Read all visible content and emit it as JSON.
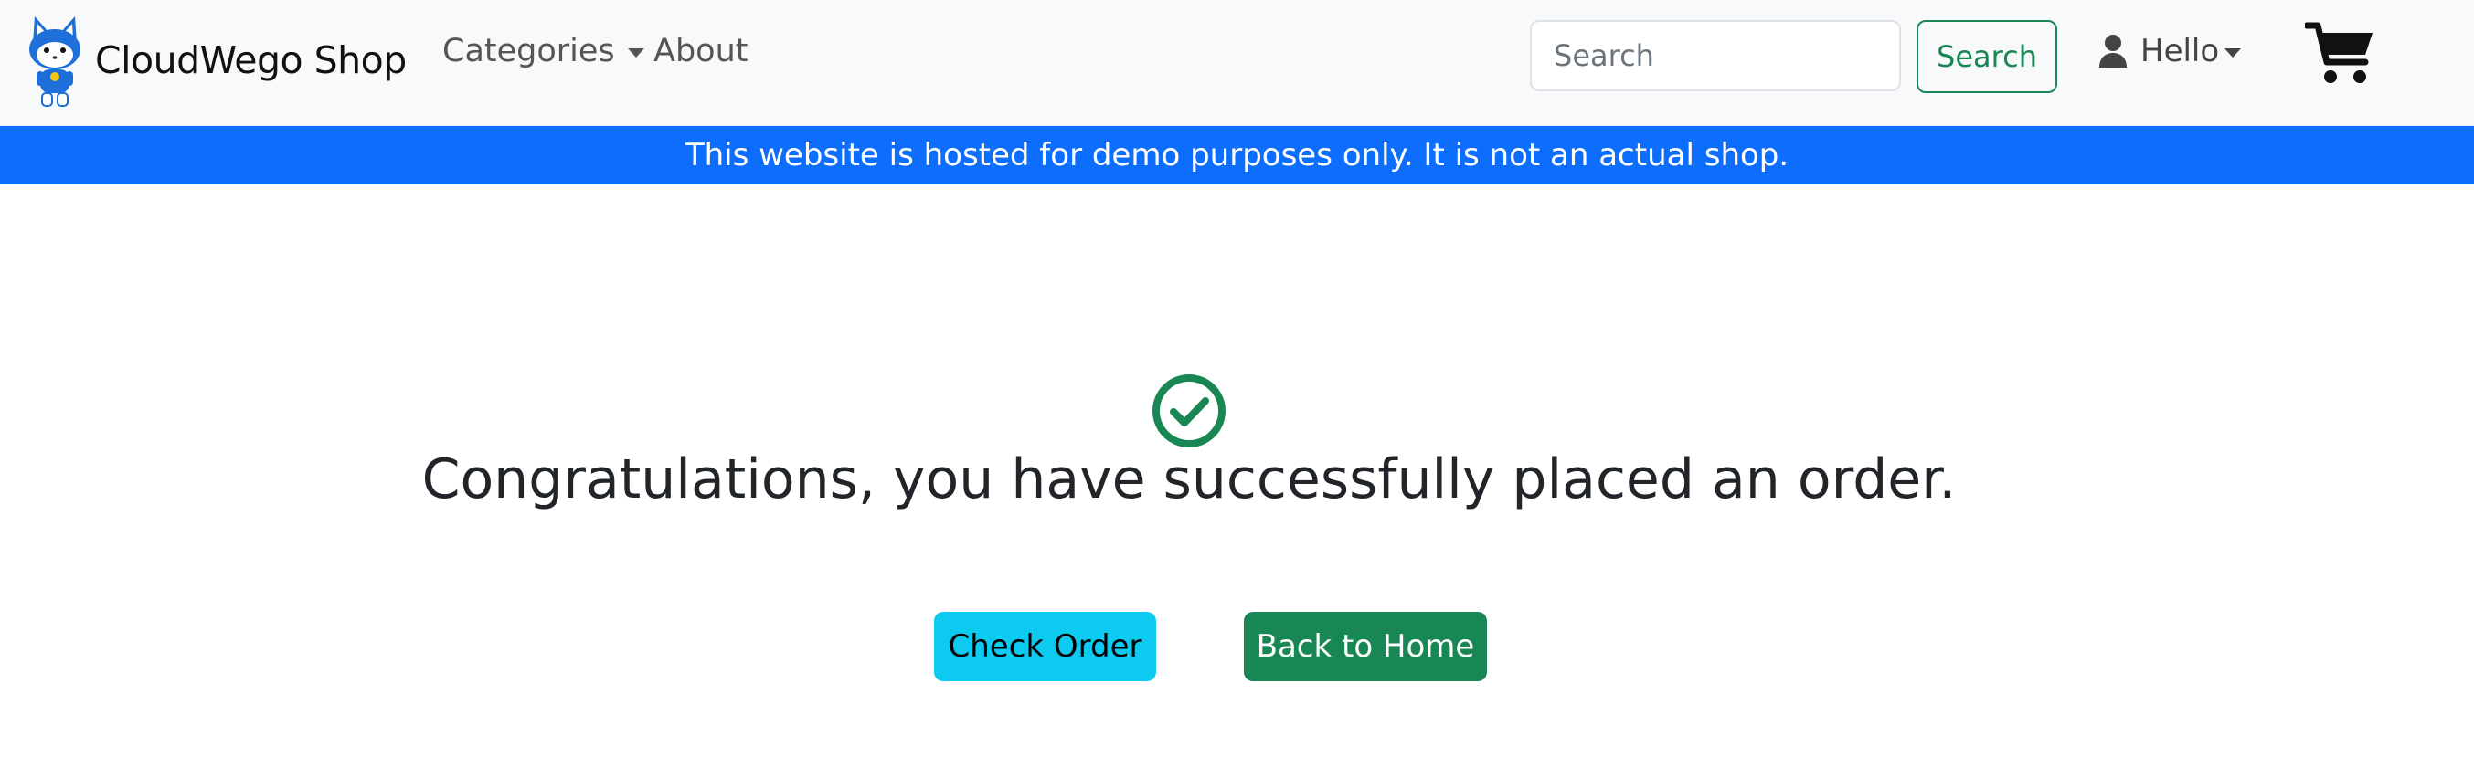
{
  "header": {
    "brand": "CloudWego Shop",
    "nav": {
      "categories": "Categories",
      "about": "About"
    },
    "search": {
      "placeholder": "Search",
      "value": "",
      "button": "Search"
    },
    "user": {
      "label": "Hello"
    }
  },
  "banner": {
    "text": "This website is hosted for demo purposes only. It is not an actual shop."
  },
  "main": {
    "message": "Congratulations, you have successfully placed an order.",
    "check_order": "Check Order",
    "back_home": "Back to Home"
  },
  "colors": {
    "primary": "#0d6efd",
    "success": "#198754",
    "info": "#0dcaf0",
    "navbar_bg": "#f8f9fa"
  },
  "icons": [
    "mascot-logo",
    "caret-down-icon",
    "user-icon",
    "cart-icon",
    "check-circle-icon"
  ]
}
